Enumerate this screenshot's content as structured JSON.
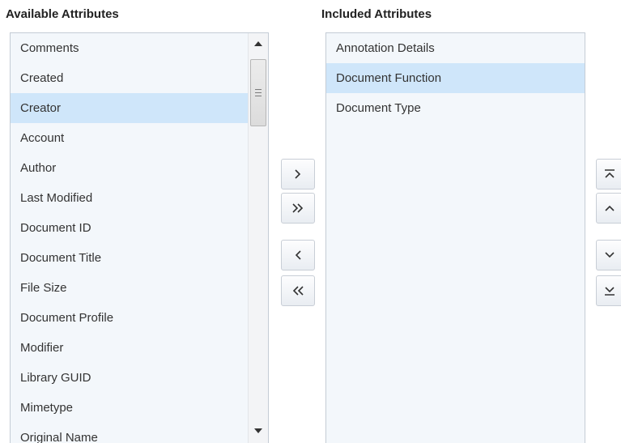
{
  "available": {
    "title": "Available Attributes",
    "items": [
      "Comments",
      "Created",
      "Creator",
      "Account",
      "Author",
      "Last Modified",
      "Document ID",
      "Document Title",
      "File Size",
      "Document Profile",
      "Modifier",
      "Library GUID",
      "Mimetype",
      "Original Name"
    ],
    "selected_index": 2
  },
  "included": {
    "title": "Included Attributes",
    "items": [
      "Annotation Details",
      "Document Function",
      "Document Type"
    ],
    "selected_index": 1
  },
  "transfer_buttons": {
    "move_right": "chevron-right-icon",
    "move_all_right": "double-chevron-right-icon",
    "move_left": "chevron-left-icon",
    "move_all_left": "double-chevron-left-icon"
  },
  "order_buttons": {
    "move_top": "move-to-top-icon",
    "move_up": "chevron-up-icon",
    "move_down": "chevron-down-icon",
    "move_bottom": "move-to-bottom-icon"
  },
  "colors": {
    "selection": "#cfe6fa",
    "list_background": "#f3f7fb",
    "border": "#c4ccd5"
  }
}
